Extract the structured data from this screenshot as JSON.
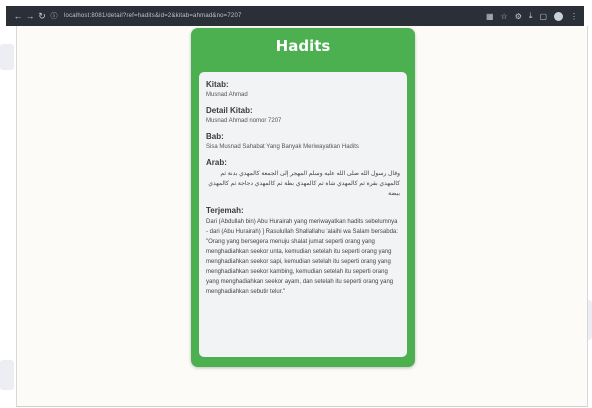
{
  "browser": {
    "url": "localhost:8081/detail?ref=hadits&id=2&kitab=ahmad&no=7207"
  },
  "card": {
    "title": "Hadits",
    "kitab_label": "Kitab:",
    "kitab_value": "Musnad Ahmad",
    "detail_label": "Detail Kitab:",
    "detail_value": "Musnad Ahmad nomor 7207",
    "bab_label": "Bab:",
    "bab_value": "Sisa Musnad Sahabat Yang Banyak Meriwayatkan Hadits",
    "arab_label": "Arab:",
    "arab_value": "وقال رسول الله صلى الله عليه وسلم المهجر إلى الجمعة كالمهدي بدنة ثم كالمهدي بقرة ثم كالمهدي شاة ثم كالمهدي بطة ثم كالمهدي دجاجة ثم كالمهدي بيضة",
    "terjemah_label": "Terjemah:",
    "terjemah_value": "Dari (Abdullah bin) Abu Hurairah yang meriwayatkan hadits sebelumnya - dari (Abu Hurairah) ] Rasulullah Shallallahu 'alaihi wa Salam bersabda: \"Orang yang bersegera menuju shalat jumat seperti orang yang menghadiahkan seekor unta, kemudian setelah itu seperti orang yang menghadiahkan seekor sapi, kemudian setelah itu seperti orang yang menghadiahkan seekor kambing, kemudian setelah itu seperti orang yang menghadiahkan seekor ayam, dan setelah itu seperti orang yang menghadiahkan sebutir telur.\""
  },
  "colors": {
    "card_green": "#4caf50",
    "inner_gray": "#f1f3f4",
    "chrome_dark": "#2b2f37"
  }
}
